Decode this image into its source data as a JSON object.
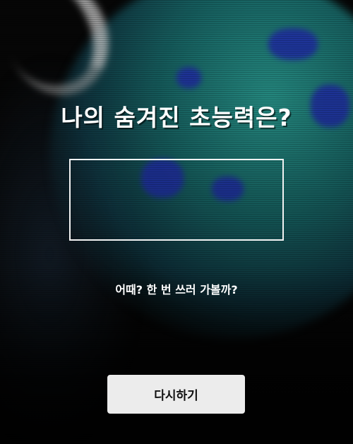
{
  "title": "나의 숨겨진 초능력은?",
  "result": {
    "text": ""
  },
  "prompt": "어때? 한 번 쓰러 가볼까?",
  "retry_button": {
    "label": "다시하기"
  },
  "colors": {
    "background": "#060606",
    "text": "#ffffff",
    "box_border": "#f2f2f2",
    "button_bg": "#ececec",
    "button_text": "#111111",
    "planet": "#1e7c7a",
    "planet_spots": "#1f2fa0"
  }
}
